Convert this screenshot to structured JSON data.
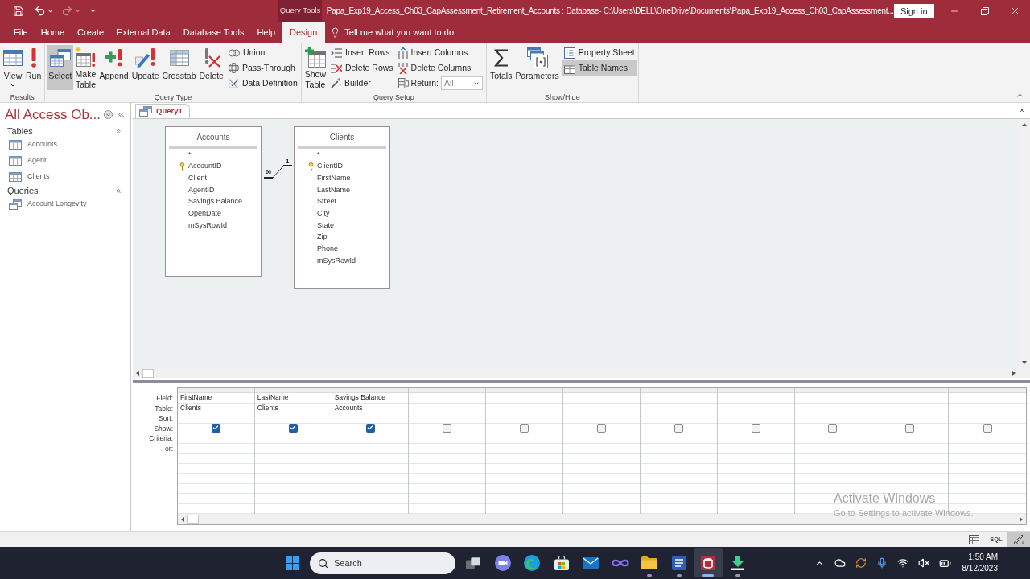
{
  "title_bar": {
    "context_label": "Query Tools",
    "title": "Papa_Exp19_Access_Ch03_CapAssessment_Retirement_Accounts : Database- C:\\Users\\DELL\\OneDrive\\Documents\\Papa_Exp19_Access_Ch03_CapAssessment...",
    "sign_in": "Sign in"
  },
  "ribbon_tabs": [
    {
      "label": "File",
      "selected": false
    },
    {
      "label": "Home",
      "selected": false
    },
    {
      "label": "Create",
      "selected": false
    },
    {
      "label": "External Data",
      "selected": false
    },
    {
      "label": "Database Tools",
      "selected": false
    },
    {
      "label": "Help",
      "selected": false
    },
    {
      "label": "Design",
      "selected": true
    }
  ],
  "tell_me": "Tell me what you want to do",
  "ribbon_groups": [
    {
      "label": "Results",
      "items": [
        {
          "kind": "large",
          "label": "View",
          "menu": true
        },
        {
          "kind": "large",
          "label": "Run",
          "menu": false
        }
      ]
    },
    {
      "label": "Query Type",
      "items": [
        {
          "kind": "large",
          "label": "Select",
          "selected": true
        },
        {
          "kind": "large",
          "label": "Make Table",
          "selected": false
        },
        {
          "kind": "large",
          "label": "Append",
          "selected": false
        },
        {
          "kind": "large",
          "label": "Update",
          "selected": false
        },
        {
          "kind": "large",
          "label": "Crosstab",
          "selected": false
        },
        {
          "kind": "large",
          "label": "Delete",
          "selected": false
        },
        {
          "kind": "stack",
          "items": [
            {
              "kind": "small",
              "label": "Union",
              "selected": false
            },
            {
              "kind": "small",
              "label": "Pass-Through",
              "selected": false
            },
            {
              "kind": "small",
              "label": "Data Definition",
              "selected": false
            }
          ]
        }
      ]
    },
    {
      "label": "Query Setup",
      "items": [
        {
          "kind": "large",
          "label": "Show Table"
        },
        {
          "kind": "stack",
          "items": [
            {
              "kind": "small",
              "label": "Insert Rows"
            },
            {
              "kind": "small",
              "label": "Delete Rows"
            },
            {
              "kind": "small",
              "label": "Builder"
            }
          ]
        },
        {
          "kind": "stack",
          "items": [
            {
              "kind": "small",
              "label": "Insert Columns"
            },
            {
              "kind": "small",
              "label": "Delete Columns"
            },
            {
              "kind": "combo",
              "label": "Return:",
              "value": "All"
            }
          ]
        }
      ]
    },
    {
      "label": "Show/Hide",
      "items": [
        {
          "kind": "large",
          "label": "Totals"
        },
        {
          "kind": "large",
          "label": "Parameters"
        },
        {
          "kind": "stack",
          "items": [
            {
              "kind": "small",
              "label": "Property Sheet",
              "on": false
            },
            {
              "kind": "small",
              "label": "Table Names",
              "on": true
            }
          ]
        }
      ]
    }
  ],
  "navigation_pane": {
    "title": "All Access Ob...",
    "groups": [
      {
        "label": "Tables",
        "kind": "table",
        "expanded": true,
        "items": [
          "Accounts",
          "Agent",
          "Clients"
        ]
      },
      {
        "label": "Queries",
        "kind": "query",
        "expanded": true,
        "items": [
          "Account Longevity"
        ]
      }
    ]
  },
  "document_tabs": [
    {
      "label": "Query1",
      "selected": true
    }
  ],
  "design_tables": [
    {
      "name": "Accounts",
      "fields": [
        {
          "name": "*",
          "key": false
        },
        {
          "name": "AccountID",
          "key": true
        },
        {
          "name": "Client",
          "key": false
        },
        {
          "name": "AgentID",
          "key": false
        },
        {
          "name": "Savings Balance",
          "key": false
        },
        {
          "name": "OpenDate",
          "key": false
        },
        {
          "name": "mSysRowId",
          "key": false
        }
      ]
    },
    {
      "name": "Clients",
      "fields": [
        {
          "name": "*",
          "key": false
        },
        {
          "name": "ClientID",
          "key": true
        },
        {
          "name": "FirstName",
          "key": false
        },
        {
          "name": "LastName",
          "key": false
        },
        {
          "name": "Street",
          "key": false
        },
        {
          "name": "City",
          "key": false
        },
        {
          "name": "State",
          "key": false
        },
        {
          "name": "Zip",
          "key": false
        },
        {
          "name": "Phone",
          "key": false
        },
        {
          "name": "mSysRowId",
          "key": false
        }
      ]
    }
  ],
  "relationship": {
    "many_side": "∞",
    "one_side": "1"
  },
  "query_grid": {
    "row_labels": [
      "Field:",
      "Table:",
      "Sort:",
      "Show:",
      "Criteria:",
      "or:"
    ],
    "columns": [
      {
        "field": "FirstName",
        "table": "Clients",
        "show": true
      },
      {
        "field": "LastName",
        "table": "Clients",
        "show": true
      },
      {
        "field": "Savings Balance",
        "table": "Accounts",
        "show": true
      },
      {
        "show": false
      },
      {
        "show": false
      },
      {
        "show": false
      },
      {
        "show": false
      },
      {
        "show": false
      },
      {
        "show": false
      },
      {
        "show": false
      },
      {
        "show": false
      }
    ]
  },
  "status_bar": {
    "views": [
      {
        "kind": "datasheet",
        "selected": false
      },
      {
        "kind": "sql",
        "label": "SQL",
        "selected": false
      },
      {
        "kind": "design",
        "selected": true
      }
    ]
  },
  "activation_notice": {
    "title": "Activate Windows",
    "message": "Go to Settings to activate Windows."
  },
  "taskbar": {
    "search": {
      "placeholder": "Search"
    },
    "apps": [
      {
        "running": false,
        "active": false
      },
      {
        "running": false,
        "active": false
      },
      {
        "running": false,
        "active": false
      },
      {
        "running": false,
        "active": false
      },
      {
        "running": false,
        "active": false
      },
      {
        "running": false,
        "active": false
      },
      {
        "running": true,
        "active": false
      },
      {
        "running": true,
        "active": false
      },
      {
        "running": true,
        "active": true
      },
      {
        "running": true,
        "active": false
      }
    ],
    "clock": {
      "time": "1:50 AM",
      "date": "8/12/2023"
    }
  }
}
